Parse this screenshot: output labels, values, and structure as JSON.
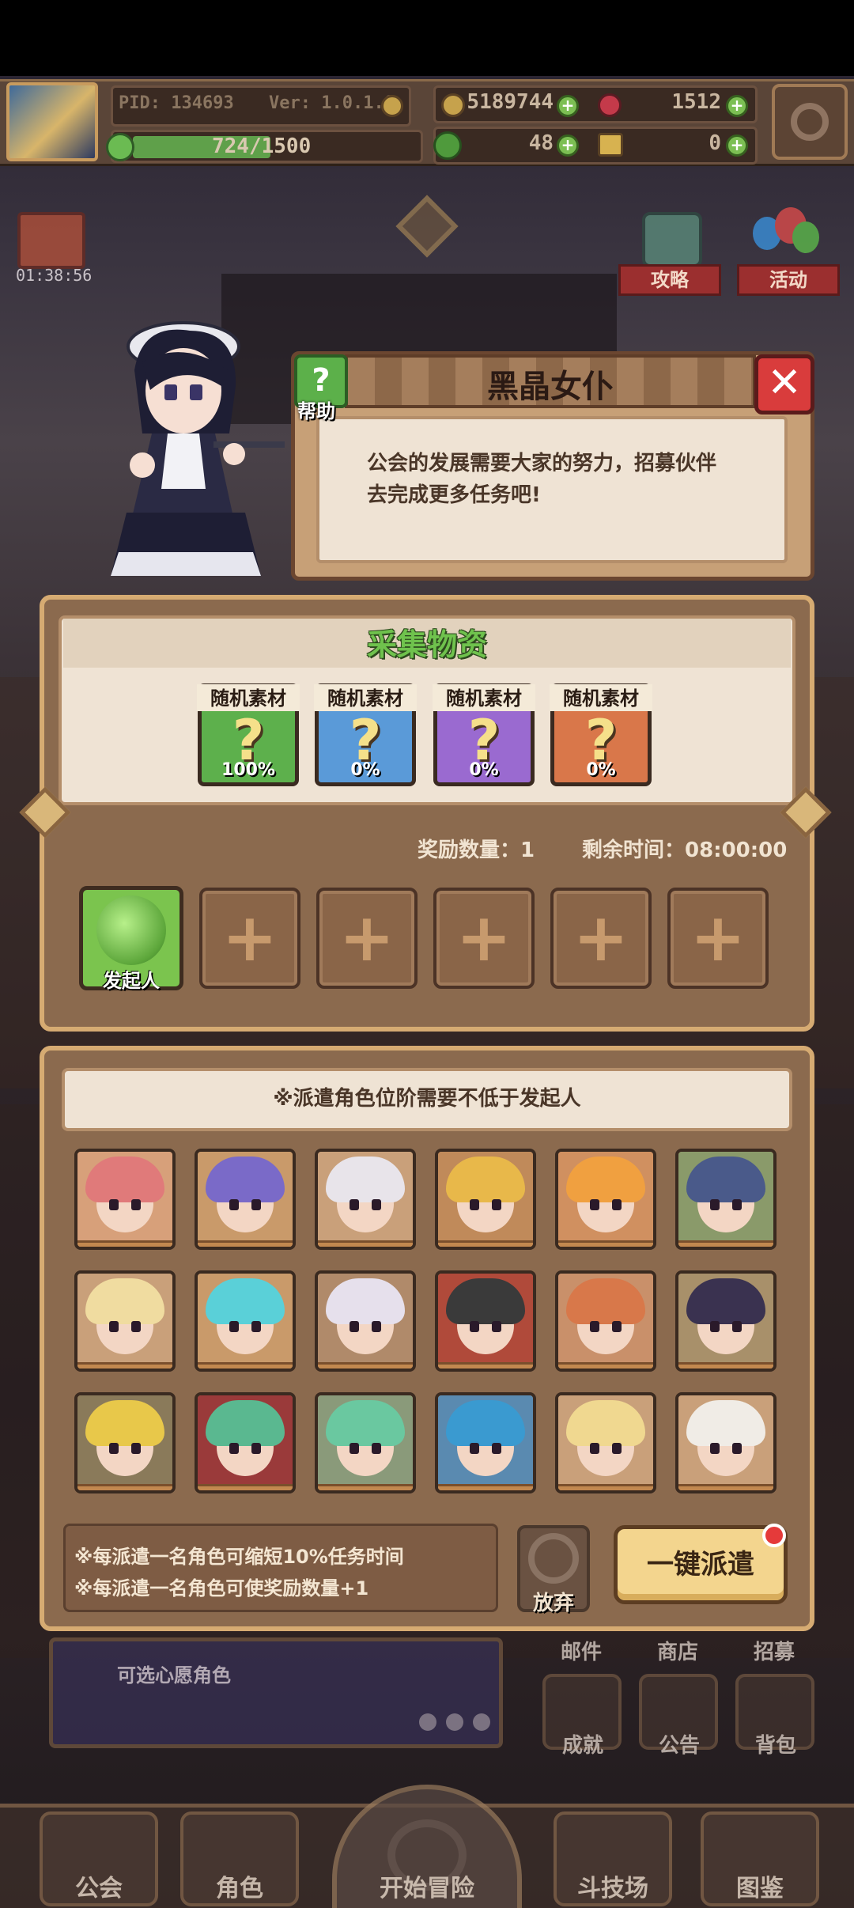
{
  "topbar": {
    "pid": "PID: 134693",
    "version": "Ver: 1.0.1.0",
    "exp": "724/1500",
    "exp_fraction": 0.483,
    "coins": "5189744",
    "gems": "1512",
    "clover": "48",
    "keys": "0"
  },
  "timer": "01:38:56",
  "side_buttons": {
    "guide": "攻略",
    "event": "活动"
  },
  "dialog": {
    "title": "黑晶女仆",
    "help_label": "帮助",
    "message_line1": "公会的发展需要大家的努力，招募伙伴",
    "message_line2": "去完成更多任务吧!"
  },
  "gather": {
    "title": "采集物资",
    "materials": [
      {
        "label": "随机素材",
        "pct": "100%",
        "color": "#5db04c"
      },
      {
        "label": "随机素材",
        "pct": "0%",
        "color": "#5a9ad8"
      },
      {
        "label": "随机素材",
        "pct": "0%",
        "color": "#9a6ad0"
      },
      {
        "label": "随机素材",
        "pct": "0%",
        "color": "#d9774a"
      }
    ],
    "reward": "奖励数量：1",
    "time_left": "剩余时间：08:00:00",
    "initiator_label": "发起人"
  },
  "dispatch": {
    "note": "※派遣角色位阶需要不低于发起人",
    "tip1": "※每派遣一名角色可缩短10%任务时间",
    "tip2": "※每派遣一名角色可使奖励数量+1",
    "abandon_label": "放弃",
    "dispatch_all_label": "一键派遣",
    "heroes": [
      {
        "hair": "#e07a7a",
        "bg": "#d7a07a"
      },
      {
        "hair": "#7a6ac8",
        "bg": "#c99a6a"
      },
      {
        "hair": "#e8e4ea",
        "bg": "#c9a07a"
      },
      {
        "hair": "#e8b84a",
        "bg": "#c08a5a"
      },
      {
        "hair": "#f0a040",
        "bg": "#d09060"
      },
      {
        "hair": "#4a5a8a",
        "bg": "#8a9a6a"
      },
      {
        "hair": "#f0dca0",
        "bg": "#c9a07a"
      },
      {
        "hair": "#5ad0d8",
        "bg": "#c99a6a"
      },
      {
        "hair": "#e6e0ec",
        "bg": "#b08a6a"
      },
      {
        "hair": "#3a3a3a",
        "bg": "#b04a3a"
      },
      {
        "hair": "#d8784a",
        "bg": "#c9906a"
      },
      {
        "hair": "#3a3250",
        "bg": "#a8906a"
      },
      {
        "hair": "#e8c84a",
        "bg": "#8a7a5a"
      },
      {
        "hair": "#5ab890",
        "bg": "#9a3a3a"
      },
      {
        "hair": "#6ac8a0",
        "bg": "#8a9a7a"
      },
      {
        "hair": "#3a9ad0",
        "bg": "#5a8ab0"
      },
      {
        "hair": "#f0d890",
        "bg": "#c9a07a"
      },
      {
        "hair": "#f0ece6",
        "bg": "#c9a07a"
      }
    ]
  },
  "menu": {
    "wish": "可选心愿角色",
    "mail": "邮件",
    "shop": "商店",
    "recruit": "招募",
    "achievement": "成就",
    "notice": "公告",
    "bag": "背包"
  },
  "nav": {
    "guild": "公会",
    "character": "角色",
    "adventure": "开始冒险",
    "arena": "斗技场",
    "codex": "图鉴"
  }
}
